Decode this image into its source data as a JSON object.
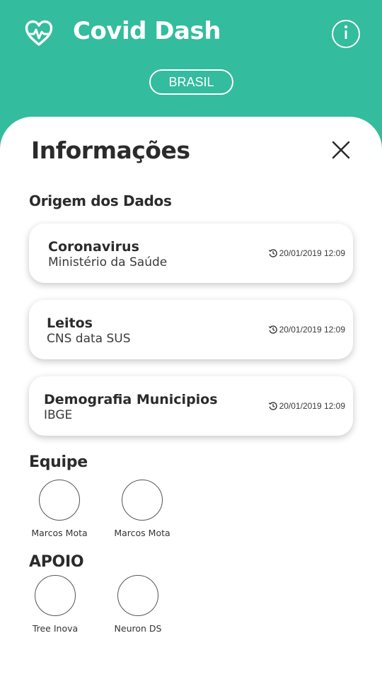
{
  "app": {
    "title": "Covid Dash",
    "country": "BRASIL",
    "brand_color": "#33bc9e",
    "logo_icon": "heart-pulse-icon",
    "info_icon": "info-icon"
  },
  "panel": {
    "title": "Informações",
    "close_icon": "close-icon",
    "sources_heading": "Origem dos Dados",
    "sources": [
      {
        "name": "Coronavirus",
        "provider": "Ministério da Saúde",
        "updated": "20/01/2019 12:09"
      },
      {
        "name": "Leitos",
        "provider": "CNS data SUS",
        "updated": "20/01/2019 12:09"
      },
      {
        "name": "Demografia Municipios",
        "provider": "IBGE",
        "updated": "20/01/2019 12:09"
      }
    ],
    "team_heading": "Equipe",
    "team": [
      {
        "name": "Marcos Mota"
      },
      {
        "name": "Marcos Mota"
      }
    ],
    "support_heading": "APOIO",
    "support": [
      {
        "name": "Tree Inova"
      },
      {
        "name": "Neuron DS"
      }
    ]
  }
}
